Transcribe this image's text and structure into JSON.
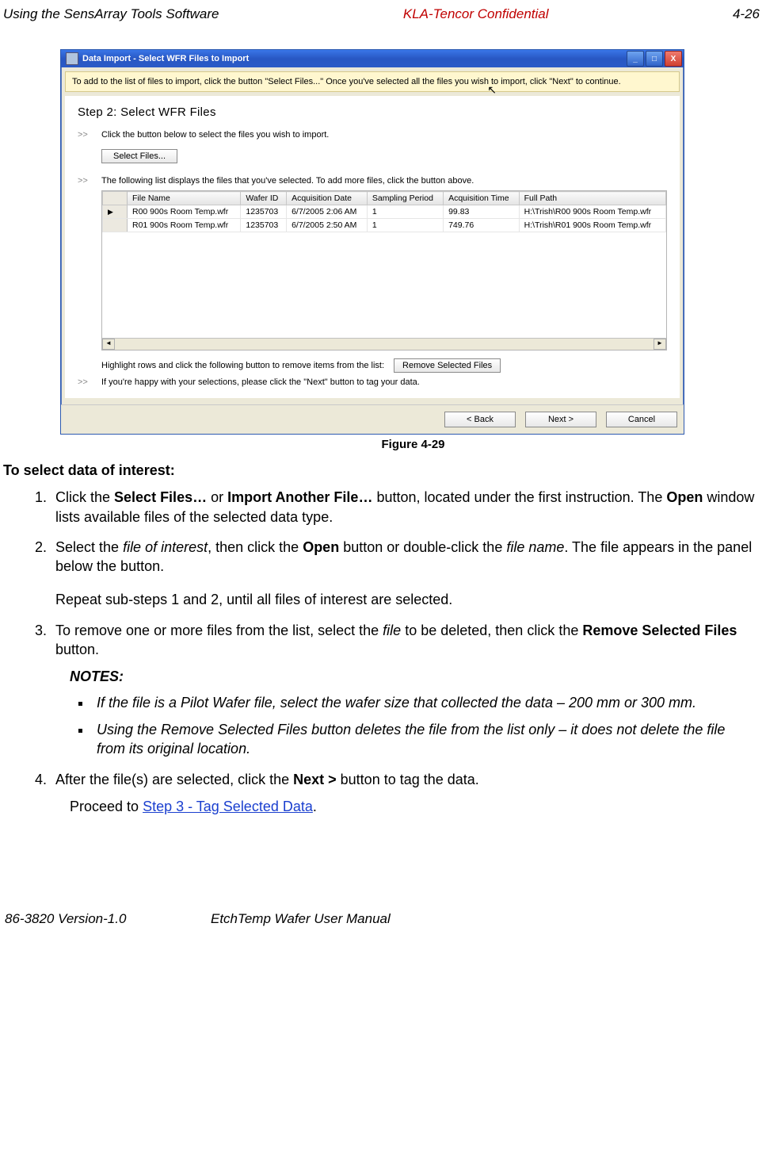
{
  "header": {
    "left": "Using the SensArray Tools Software",
    "mid": "KLA-Tencor Confidential",
    "right": "4-26"
  },
  "window": {
    "title": "Data Import - Select WFR Files to Import",
    "infobar": "To add to the list of files to import, click the button \"Select Files...\"  Once you've selected all the files you wish to import, click \"Next\" to continue.",
    "step_title": "Step 2: Select WFR Files",
    "instr1": "Click the button below to select the files you wish to import.",
    "select_btn": "Select Files...",
    "instr2": "The following list displays the files that you've selected.  To add more files, click the button above.",
    "columns": [
      "File Name",
      "Wafer ID",
      "Acquisition Date",
      "Sampling Period",
      "Acquisition Time",
      "Full Path"
    ],
    "rows": [
      {
        "mark": "▶",
        "file": "R00 900s Room Temp.wfr",
        "wid": "1235703",
        "acq": "6/7/2005 2:06 AM",
        "sp": "1",
        "at": "99.83",
        "path": "H:\\Trish\\R00 900s Room Temp.wfr"
      },
      {
        "mark": "",
        "file": "R01 900s Room Temp.wfr",
        "wid": "1235703",
        "acq": "6/7/2005 2:50 AM",
        "sp": "1",
        "at": "749.76",
        "path": "H:\\Trish\\R01 900s Room Temp.wfr"
      }
    ],
    "remove_label": "Highlight rows and click the following button to remove items from the list:",
    "remove_btn": "Remove Selected Files",
    "instr3": "If you're happy with your selections, please click the \"Next\" button to tag your data.",
    "nav": {
      "back": "< Back",
      "next": "Next >",
      "cancel": "Cancel"
    }
  },
  "caption": "Figure 4-29",
  "doc": {
    "sect_head": "To select data of interest:",
    "li1a": "Click the ",
    "li1b": "Select Files…",
    "li1c": " or ",
    "li1d": "Import Another File…",
    "li1e": " button, located under the first instruction. The ",
    "li1f": "Open",
    "li1g": " window lists available files of the selected data type.",
    "li2a": "Select the ",
    "li2b": "file of interest",
    "li2c": ", then click the ",
    "li2d": "Open",
    "li2e": " button or double-click the ",
    "li2f": "file name",
    "li2g": ". The file appears in the panel below the button.",
    "li2_repeat": "Repeat sub-steps 1 and 2, until all files of interest are selected.",
    "li3a": "To remove one or more files from the list, select the ",
    "li3b": "file",
    "li3c": " to be deleted, then click the ",
    "li3d": "Remove Selected Files",
    "li3e": " button.",
    "notes_h": "NOTES:",
    "note1": "If the file is a Pilot Wafer file, select the wafer size that collected the data – 200 mm or 300 mm.",
    "note2": "Using the Remove Selected Files button deletes the file from the list only – it does not delete the file from its original location.",
    "li4a": "After the file(s) are selected, click the ",
    "li4b": "Next >",
    "li4c": " button to tag the data.",
    "proceed_a": "Proceed to ",
    "proceed_link": "Step 3 - Tag Selected Data",
    "proceed_b": "."
  },
  "footer": {
    "left": "86-3820 Version-1.0",
    "mid": "EtchTemp Wafer User Manual"
  }
}
